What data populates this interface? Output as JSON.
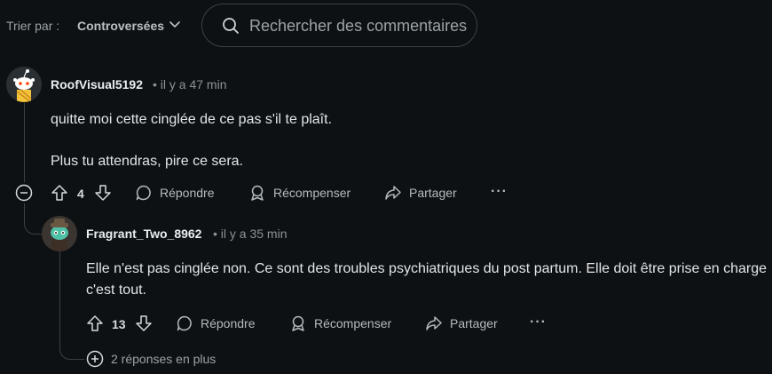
{
  "sort": {
    "label": "Trier par :",
    "value": "Controversées"
  },
  "search": {
    "placeholder": "Rechercher des commentaires"
  },
  "comments": [
    {
      "username": "RoofVisual5192",
      "meta": "• il y a 47 min",
      "paragraphs": [
        "quitte moi cette cinglée de ce pas s'il te plaît.",
        "Plus tu attendras, pire ce sera."
      ],
      "score": "4",
      "actions": {
        "reply": "Répondre",
        "award": "Récompenser",
        "share": "Partager",
        "more": "···"
      },
      "colors": {
        "avatar_bg": "#f5c33a"
      }
    },
    {
      "username": "Fragrant_Two_8962",
      "meta": "• il y a 35 min",
      "text": "Elle n'est pas cinglée non. Ce sont des troubles psychiatriques du post partum. Elle doit être prise en charge c'est tout.",
      "score": "13",
      "actions": {
        "reply": "Répondre",
        "award": "Récompenser",
        "share": "Partager",
        "more": "···"
      },
      "more_replies": "2 réponses en plus",
      "colors": {
        "avatar_bg": "#4fc1a6"
      }
    }
  ]
}
